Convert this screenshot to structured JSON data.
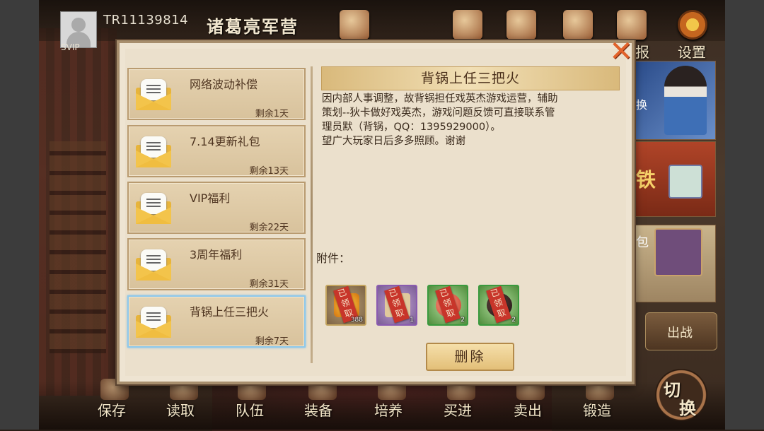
{
  "header": {
    "player_id": "TR11139814",
    "vip": "SVIP",
    "camp_name": "诸葛亮军营",
    "right_labels": [
      "报",
      "设置"
    ]
  },
  "side": {
    "banner1_text": "换",
    "banner2_text": "铁",
    "banner3_text": "包",
    "battle_label": "出战"
  },
  "bottom_nav": [
    "保存",
    "读取",
    "队伍",
    "装备",
    "培养",
    "买进",
    "卖出",
    "锻造"
  ],
  "switch_label": [
    "切",
    "换"
  ],
  "mail": {
    "items": [
      {
        "title": "网络波动补偿",
        "remain": "剩余1天"
      },
      {
        "title": "7.14更新礼包",
        "remain": "剩余13天"
      },
      {
        "title": "VIP福利",
        "remain": "剩余22天"
      },
      {
        "title": "3周年福利",
        "remain": "剩余31天"
      },
      {
        "title": "背锅上任三把火",
        "remain": "剩余7天"
      }
    ],
    "selected_index": 4,
    "detail": {
      "title": "背锅上任三把火",
      "body_lines": [
        "因内部人事调整，故背锅担任戏英杰游戏运营，辅助",
        "策划--狄卡做好戏英杰，游戏问题反馈可直接联系管",
        "理员默（背锅，QQ：1395929000）。",
        "望广大玩家日后多多照顾。谢谢"
      ],
      "attach_label": "附件：",
      "attachments": [
        {
          "icon": "gold-ingot-icon",
          "claimed": "已领取",
          "qty": "388",
          "rarity": "gold"
        },
        {
          "icon": "scroll-box-icon",
          "claimed": "已领取",
          "qty": "1",
          "rarity": "purple"
        },
        {
          "icon": "peach-icon",
          "claimed": "已领取",
          "qty": "2",
          "rarity": "green"
        },
        {
          "icon": "dark-pill-icon",
          "claimed": "已领取",
          "qty": "2",
          "rarity": "green"
        }
      ],
      "delete_label": "删除"
    }
  },
  "colors": {
    "dialog_bg": "#ebe0cc",
    "selected_border": "#8ec8ea",
    "close_color": "#e2622a",
    "claimed_ribbon": "#c8352a"
  }
}
